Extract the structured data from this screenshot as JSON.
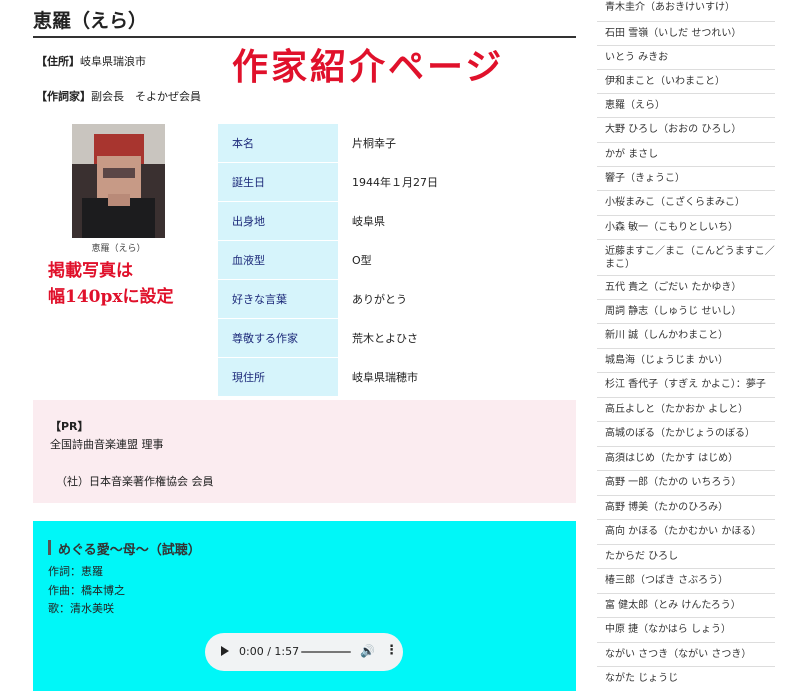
{
  "page": {
    "title": "恵羅（えら）",
    "overlay_title": "作家紹介ページ",
    "info": [
      {
        "key": "【住所】",
        "value": "岐阜県瑞浪市"
      },
      {
        "key": "【作詞家】",
        "value": "副会長　そよかぜ会員"
      }
    ],
    "photo_caption": "恵羅（えら）",
    "overlay_note": [
      "掲載写真は",
      "幅140pxに設定"
    ]
  },
  "profile": [
    {
      "key": "本名",
      "value": "片桐幸子"
    },
    {
      "key": "誕生日",
      "value": "1944年１月27日"
    },
    {
      "key": "出身地",
      "value": "岐阜県"
    },
    {
      "key": "血液型",
      "value": "O型"
    },
    {
      "key": "好きな言葉",
      "value": "ありがとう"
    },
    {
      "key": "尊敬する作家",
      "value": "荒木とよひさ"
    },
    {
      "key": "現住所",
      "value": "岐阜県瑞穂市"
    }
  ],
  "pr": {
    "heading": "【PR】",
    "lines": [
      "全国詩曲音楽連盟 理事",
      "（社）日本音楽著作権協会 会員"
    ]
  },
  "song": {
    "title": "めぐる愛〜母〜（試聴）",
    "credits": [
      "作詞：恵羅",
      "作曲：橋本博之",
      "歌：清水美咲"
    ],
    "player_time": "0:00 / 1:57"
  },
  "icons": {
    "play": "play-icon",
    "volume": "volume-icon",
    "more": "more-icon"
  },
  "sidebar": [
    "青木圭介（あおきけいすけ）",
    "石田 雪嶺（いしだ せつれい）",
    "いとう みきお",
    "伊和まこと（いわまこと）",
    "恵羅（えら）",
    "大野 ひろし（おおの ひろし）",
    "かが まさし",
    "響子（きょうこ）",
    "小桜まみこ（こざくらまみこ）",
    "小森 敏一（こもりとしいち）",
    "近藤ますこ／まこ（こんどうますこ／まこ）",
    "五代 貴之（ごだい たかゆき）",
    "周詞 静志（しゅうじ せいし）",
    "新川 誠（しんかわまこと）",
    "城島海（じょうじま かい）",
    "杉江 香代子（すぎえ かよこ）：夢子",
    "高丘よしと（たかおか よしと）",
    "高城のぼる（たかじょうのぼる）",
    "高須はじめ（たかす はじめ）",
    "高野 一郎（たかの いちろう）",
    "高野 博美（たかのひろみ）",
    "高向 かほる（たかむかい かほる）",
    "たからだ ひろし",
    "椿三郎（つばき さぶろう）",
    "富 健太郎（とみ けんたろう）",
    "中原 捷（なかはら しょう）",
    "ながい さつき（ながい さつき）",
    "ながた じょうじ"
  ]
}
